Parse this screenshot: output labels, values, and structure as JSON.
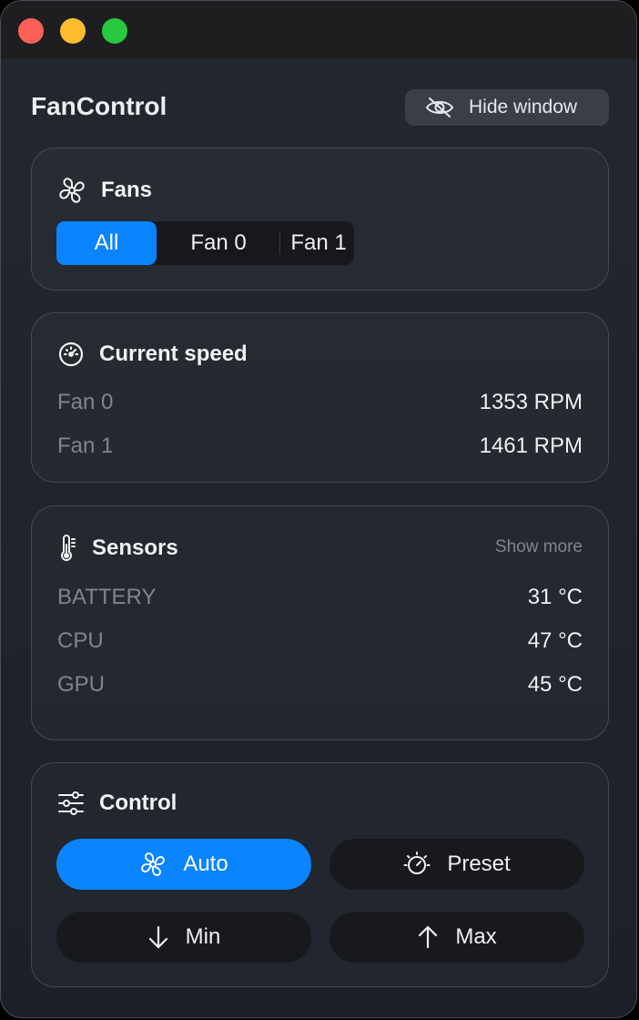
{
  "window": {
    "app_title": "FanControl",
    "hide_button_label": "Hide window",
    "hide_button_icon": "eye-slash-icon"
  },
  "fans": {
    "title": "Fans",
    "icon": "fan-icon",
    "segments": [
      "All",
      "Fan 0",
      "Fan 1"
    ],
    "selected": "All"
  },
  "current_speed": {
    "title": "Current speed",
    "icon": "speedometer-icon",
    "rows": [
      {
        "label": "Fan 0",
        "value": "1353 RPM"
      },
      {
        "label": "Fan 1",
        "value": "1461 RPM"
      }
    ]
  },
  "sensors": {
    "title": "Sensors",
    "icon": "thermometer-icon",
    "show_more": "Show more",
    "rows": [
      {
        "label": "BATTERY",
        "value": "31 °C"
      },
      {
        "label": "CPU",
        "value": "47 °C"
      },
      {
        "label": "GPU",
        "value": "45 °C"
      }
    ]
  },
  "control": {
    "title": "Control",
    "icon": "sliders-icon",
    "buttons": [
      {
        "label": "Auto",
        "icon": "fan-icon",
        "active": true
      },
      {
        "label": "Preset",
        "icon": "dial-icon",
        "active": false
      },
      {
        "label": "Min",
        "icon": "arrow-down-icon",
        "active": false
      },
      {
        "label": "Max",
        "icon": "arrow-up-icon",
        "active": false
      }
    ]
  },
  "colors": {
    "accent": "#0a84ff",
    "close": "#fe5f57",
    "minimize": "#febc2e",
    "zoom": "#28c840"
  }
}
